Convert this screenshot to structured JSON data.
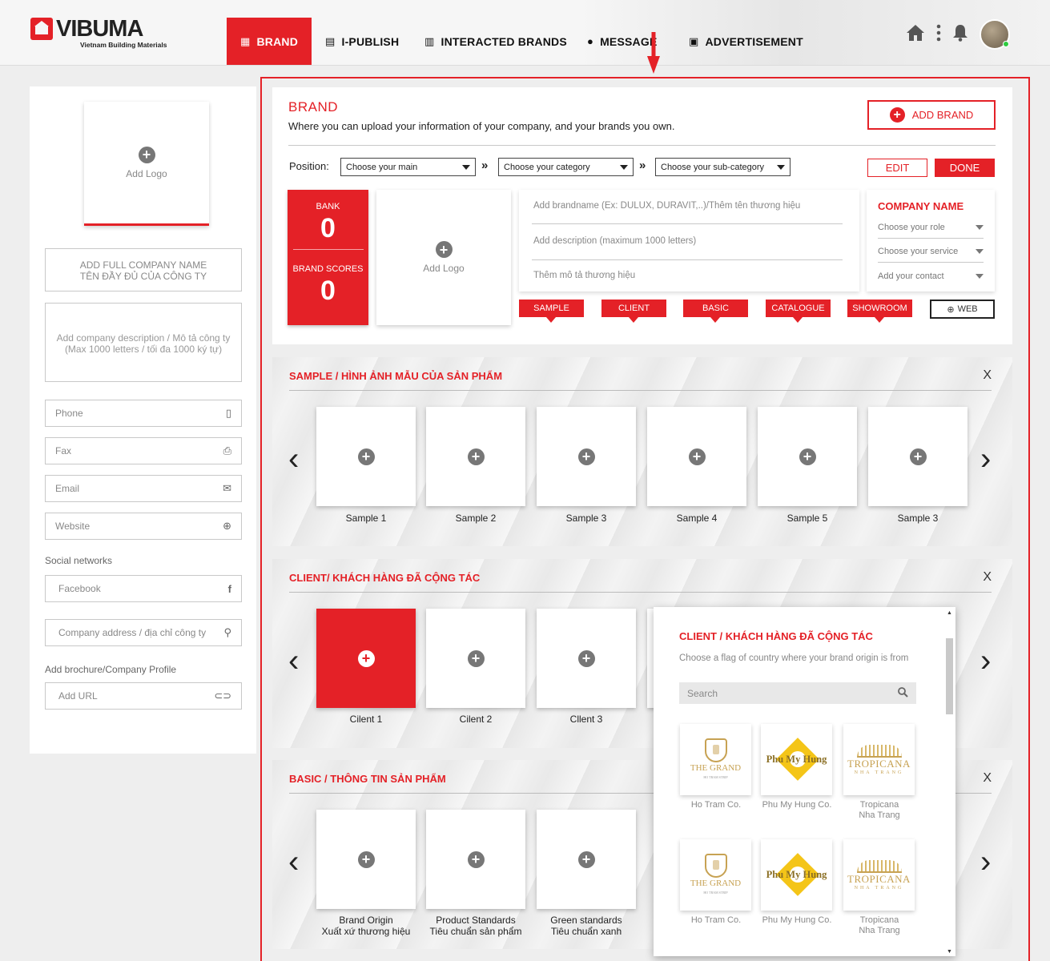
{
  "app": {
    "logo_text": "VIBUMA",
    "logo_tagline": "Vietnam Building Materials"
  },
  "nav": [
    {
      "label": "BRAND",
      "icon": "grid-icon",
      "active": true
    },
    {
      "label": "I-PUBLISH",
      "icon": "publish-icon"
    },
    {
      "label": "INTERACTED BRANDS",
      "icon": "bar-chart-icon"
    },
    {
      "label": "MESSAGE",
      "icon": "chat-icon"
    },
    {
      "label": "ADVERTISEMENT",
      "icon": "ad-icon"
    }
  ],
  "colors": {
    "accent": "#e42127",
    "background": "#eeeeee",
    "text": "#222222"
  },
  "sidebar": {
    "add_logo": "Add Logo",
    "company_name_line1": "ADD FULL COMPANY NAME",
    "company_name_line2": "TÊN ĐẦY ĐỦ CỦA CÔNG TY",
    "description_line1": "Add company description / Mô tả công ty",
    "description_line2": "(Max 1000 letters / tối đa 1000 ký tự)",
    "phone": "Phone",
    "fax": "Fax",
    "email": "Email",
    "website": "Website",
    "social_label": "Social networks",
    "facebook": "Facebook",
    "address": "Company address / địa chỉ công ty",
    "brochure_label": "Add brochure/Company Profile",
    "url": "Add URL"
  },
  "brand": {
    "title": "BRAND",
    "subtitle": "Where you can upload your information of your company, and your brands you own.",
    "add_brand": "ADD BRAND",
    "position_label": "Position:",
    "select_main": "Choose your main",
    "select_category": "Choose your category",
    "select_sub": "Choose your sub-category",
    "edit": "EDIT",
    "done": "DONE",
    "bank_label": "BANK",
    "bank_value": "0",
    "scores_label": "BRAND SCORES",
    "scores_value": "0",
    "add_logo": "Add Logo",
    "brandname_placeholder": "Add brandname (Ex: DULUX, DURAVIT,..)/Thêm tên thương hiệu",
    "description_placeholder": "Add description (maximum 1000 letters)",
    "description_vi_placeholder": "Thêm mô tả thương hiệu",
    "company_name": "COMPANY NAME",
    "role": "Choose your role",
    "service": "Choose your service",
    "contact": "Add your contact",
    "tags": [
      "SAMPLE",
      "CLIENT",
      "BASIC",
      "CATALOGUE",
      "SHOWROOM"
    ],
    "web": "WEB"
  },
  "sections": {
    "sample": {
      "title": "SAMPLE / HÌNH ẢNH MẪU CỦA SẢN PHẨM",
      "close": "X",
      "items": [
        "Sample 1",
        "Sample 2",
        "Sample 3",
        "Sample 4",
        "Sample 5",
        "Sample 3"
      ]
    },
    "client": {
      "title": "CLIENT/ KHÁCH HÀNG ĐÃ CỘNG TÁC",
      "close": "X",
      "items": [
        "Cilent 1",
        "Cilent 2",
        "Cllent 3"
      ]
    },
    "basic": {
      "title": "BASIC / THÔNG TIN SẢN PHẨM",
      "close": "X",
      "items": [
        {
          "l1": "Brand Origin",
          "l2": "Xuất xứ thương hiệu"
        },
        {
          "l1": "Product Standards",
          "l2": "Tiêu chuẩn sản phẩm"
        },
        {
          "l1": "Green standards",
          "l2": "Tiêu chuẩn xanh"
        }
      ]
    }
  },
  "popup": {
    "title": "CLIENT / KHÁCH HÀNG ĐÃ CỘNG TÁC",
    "description": "Choose a flag of country where your brand origin is from",
    "search_placeholder": "Search",
    "clients": [
      {
        "label": "Ho Tram Co.",
        "logo": "THE GRAND",
        "logo_sub": "HO TRAM STRIP"
      },
      {
        "label": "Phu My Hung Co.",
        "logo": "Phu My Hung"
      },
      {
        "label1": "Tropicana",
        "label2": "Nha Trang",
        "logo": "TROPICANA",
        "logo_sub": "NHA TRANG"
      },
      {
        "label": "Ho Tram Co.",
        "logo": "THE GRAND",
        "logo_sub": "HO TRAM STRIP"
      },
      {
        "label": "Phu My Hung Co.",
        "logo": "Phu My Hung"
      },
      {
        "label1": "Tropicana",
        "label2": "Nha Trang",
        "logo": "TROPICANA",
        "logo_sub": "NHA TRANG"
      }
    ]
  }
}
